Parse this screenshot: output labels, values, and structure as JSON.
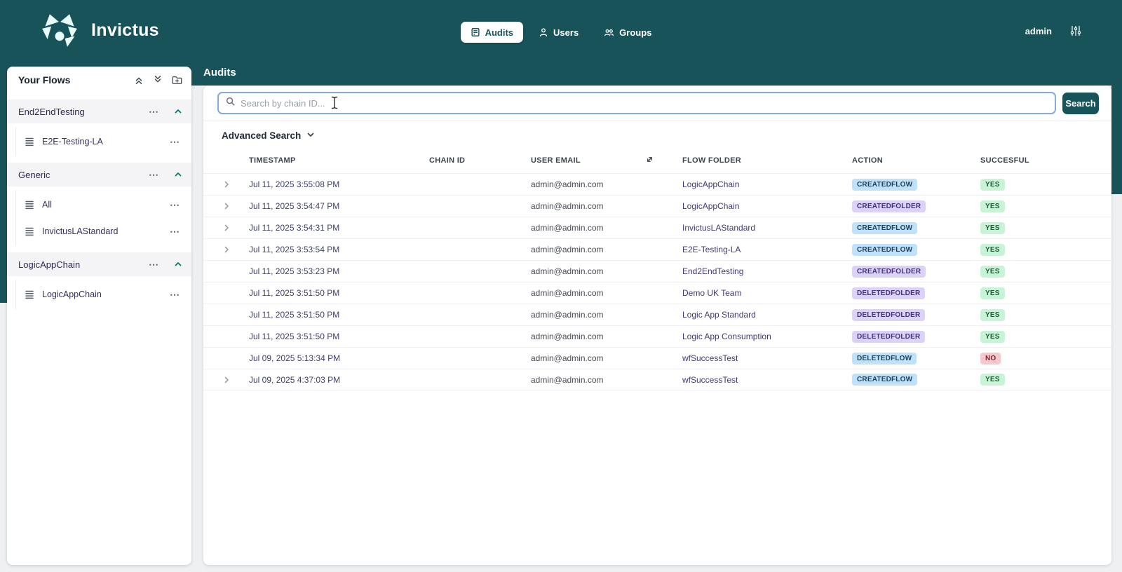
{
  "header": {
    "brand": "Invictus",
    "nav": [
      {
        "label": "Audits"
      },
      {
        "label": "Users"
      },
      {
        "label": "Groups"
      }
    ],
    "user": "admin"
  },
  "sidebar": {
    "title": "Your Flows",
    "sections": [
      {
        "label": "End2EndTesting",
        "children": [
          {
            "label": "E2E-Testing-LA"
          }
        ]
      },
      {
        "label": "Generic",
        "children": [
          {
            "label": "All"
          },
          {
            "label": "InvictusLAStandard"
          }
        ]
      },
      {
        "label": "LogicAppChain",
        "children": [
          {
            "label": "LogicAppChain"
          }
        ]
      }
    ]
  },
  "main": {
    "title": "Audits",
    "search": {
      "placeholder": "Search by chain ID...",
      "button_label": "Search"
    },
    "advanced_search_label": "Advanced Search",
    "table": {
      "columns": [
        "TIMESTAMP",
        "CHAIN ID",
        "USER EMAIL",
        "FLOW FOLDER",
        "ACTION",
        "SUCCESFUL"
      ],
      "rows": [
        {
          "expandable": true,
          "timestamp": "Jul 11, 2025 3:55:08 PM",
          "chain_id": "",
          "user_email": "admin@admin.com",
          "flow_folder": "LogicAppChain",
          "action": "CREATEDFLOW",
          "succesful": "YES"
        },
        {
          "expandable": true,
          "timestamp": "Jul 11, 2025 3:54:47 PM",
          "chain_id": "",
          "user_email": "admin@admin.com",
          "flow_folder": "LogicAppChain",
          "action": "CREATEDFOLDER",
          "succesful": "YES"
        },
        {
          "expandable": true,
          "timestamp": "Jul 11, 2025 3:54:31 PM",
          "chain_id": "",
          "user_email": "admin@admin.com",
          "flow_folder": "InvictusLAStandard",
          "action": "CREATEDFLOW",
          "succesful": "YES"
        },
        {
          "expandable": true,
          "timestamp": "Jul 11, 2025 3:53:54 PM",
          "chain_id": "",
          "user_email": "admin@admin.com",
          "flow_folder": "E2E-Testing-LA",
          "action": "CREATEDFLOW",
          "succesful": "YES"
        },
        {
          "expandable": false,
          "timestamp": "Jul 11, 2025 3:53:23 PM",
          "chain_id": "",
          "user_email": "admin@admin.com",
          "flow_folder": "End2EndTesting",
          "action": "CREATEDFOLDER",
          "succesful": "YES"
        },
        {
          "expandable": false,
          "timestamp": "Jul 11, 2025 3:51:50 PM",
          "chain_id": "",
          "user_email": "admin@admin.com",
          "flow_folder": "Demo UK Team",
          "action": "DELETEDFOLDER",
          "succesful": "YES"
        },
        {
          "expandable": false,
          "timestamp": "Jul 11, 2025 3:51:50 PM",
          "chain_id": "",
          "user_email": "admin@admin.com",
          "flow_folder": "Logic App Standard",
          "action": "DELETEDFOLDER",
          "succesful": "YES"
        },
        {
          "expandable": false,
          "timestamp": "Jul 11, 2025 3:51:50 PM",
          "chain_id": "",
          "user_email": "admin@admin.com",
          "flow_folder": "Logic App Consumption",
          "action": "DELETEDFOLDER",
          "succesful": "YES"
        },
        {
          "expandable": false,
          "timestamp": "Jul 09, 2025 5:13:34 PM",
          "chain_id": "",
          "user_email": "admin@admin.com",
          "flow_folder": "wfSuccessTest",
          "action": "DELETEDFLOW",
          "succesful": "NO"
        },
        {
          "expandable": true,
          "timestamp": "Jul 09, 2025 4:37:03 PM",
          "chain_id": "",
          "user_email": "admin@admin.com",
          "flow_folder": "wfSuccessTest",
          "action": "CREATEDFLOW",
          "succesful": "YES"
        }
      ]
    }
  },
  "colors": {
    "accent_teal": "#19535a",
    "search_border": "#84abd9",
    "badge_flow_bg": "#bfe1f9",
    "badge_folder_bg": "#dcd2f8",
    "badge_yes_bg": "#c9f3d6",
    "badge_no_bg": "#f6c7cd"
  }
}
